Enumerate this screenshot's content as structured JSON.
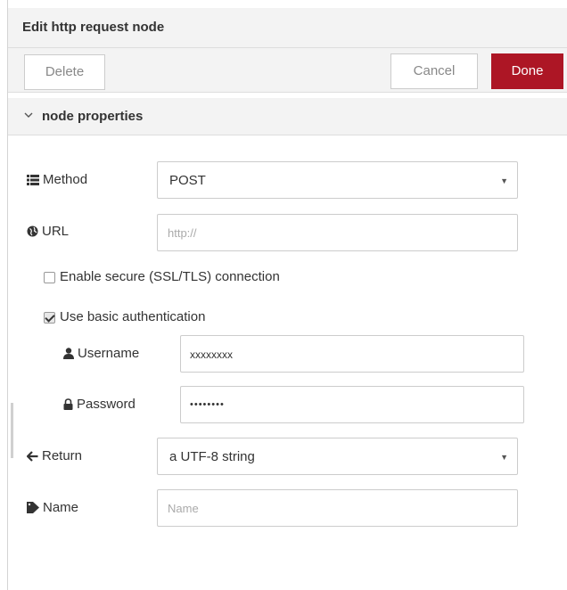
{
  "tray": {
    "title": "Edit http request node",
    "delete_label": "Delete",
    "cancel_label": "Cancel",
    "done_label": "Done"
  },
  "section": {
    "title": "node properties"
  },
  "form": {
    "method": {
      "label": "Method",
      "value": "POST"
    },
    "url": {
      "label": "URL",
      "placeholder": "http://"
    },
    "secure": {
      "label": "Enable secure (SSL/TLS) connection",
      "checked": false
    },
    "basic_auth": {
      "label": "Use basic authentication",
      "checked": true
    },
    "username": {
      "label": "Username",
      "value": "xxxxxxxx"
    },
    "password": {
      "label": "Password",
      "value": "••••••••"
    },
    "return": {
      "label": "Return",
      "value": "a UTF-8 string"
    },
    "name": {
      "label": "Name",
      "placeholder": "Name"
    }
  },
  "colors": {
    "done_button": "#ad1625",
    "header_bg": "#f3f3f3"
  }
}
